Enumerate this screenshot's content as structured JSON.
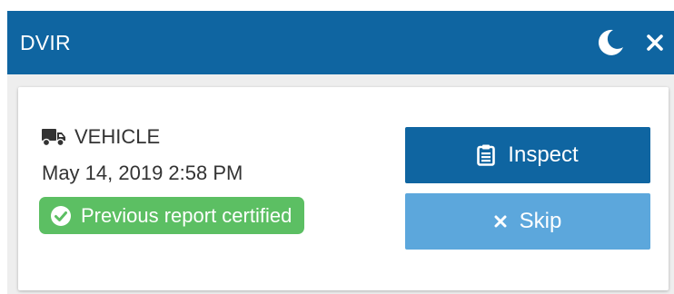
{
  "header": {
    "title": "DVIR",
    "theme_icon": "moon-icon",
    "close_icon": "close-icon",
    "color": "#0f65a1"
  },
  "report": {
    "vehicle_icon": "truck-icon",
    "vehicle_label": "VEHICLE",
    "timestamp": "May 14, 2019 2:58 PM",
    "status_icon": "check-circle-icon",
    "status_text": "Previous report certified",
    "status_color": "#5cbf63"
  },
  "actions": {
    "inspect": {
      "icon": "clipboard-icon",
      "label": "Inspect",
      "color": "#0f65a1"
    },
    "skip": {
      "icon": "x-icon",
      "label": "Skip",
      "color": "#5ca7dc"
    }
  }
}
